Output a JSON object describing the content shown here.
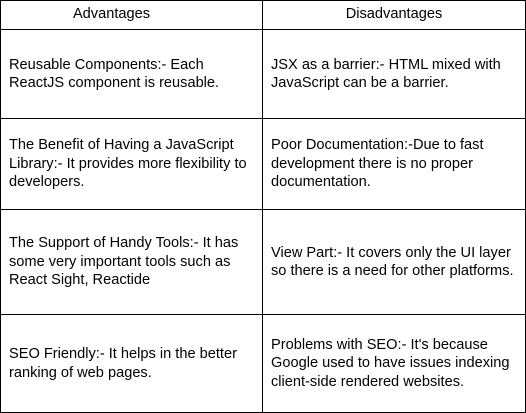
{
  "table": {
    "headers": [
      "Advantages",
      "Disadvantages"
    ],
    "rows": [
      {
        "advantage": "Reusable Components:- Each ReactJS component is reusable.",
        "disadvantage": "JSX as a barrier:- HTML mixed with JavaScript can be a barrier."
      },
      {
        "advantage": "The Benefit of Having a JavaScript Library:- It provides more flexibility to developers.",
        "disadvantage": "Poor Documentation:-Due to fast development there is no proper documentation."
      },
      {
        "advantage": "The Support of Handy Tools:- It has some very important tools such as React Sight, Reactide",
        "disadvantage": "View Part:- It covers only the UI layer so there is a need for other platforms."
      },
      {
        "advantage": "SEO Friendly:- It helps in the better ranking of web pages.",
        "disadvantage": "Problems with SEO:- It's because Google used to have issues indexing client-side rendered websites."
      }
    ]
  }
}
